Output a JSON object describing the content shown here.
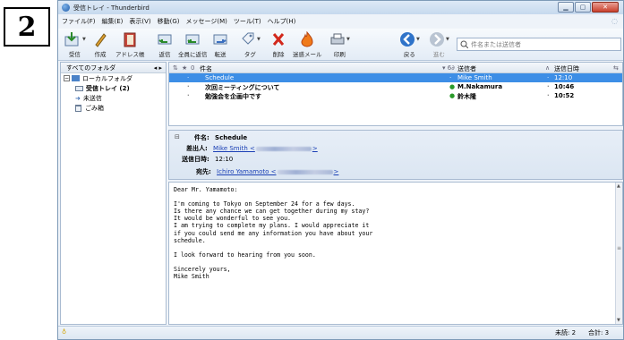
{
  "step": {
    "number": "2"
  },
  "window": {
    "title": "受信トレイ - Thunderbird"
  },
  "menubar": [
    "ファイル(F)",
    "編集(E)",
    "表示(V)",
    "移動(G)",
    "メッセージ(M)",
    "ツール(T)",
    "ヘルプ(H)"
  ],
  "toolbar": {
    "get_label": "受信",
    "write_label": "作成",
    "addressbook_label": "アドレス帳",
    "reply_label": "返信",
    "replyall_label": "全員に返信",
    "forward_label": "転送",
    "tag_label": "タグ",
    "delete_label": "削除",
    "junk_label": "迷惑メール",
    "print_label": "印刷",
    "back_label": "戻る",
    "forward_nav_label": "進む",
    "search_placeholder": "件名または送信者"
  },
  "folders": {
    "header": "すべてのフォルダ",
    "items": [
      {
        "label": "ローカルフォルダ"
      },
      {
        "label": "受信トレイ (2)"
      },
      {
        "label": "未送信"
      },
      {
        "label": "ごみ箱"
      }
    ]
  },
  "message_list": {
    "columns": {
      "subject": "件名",
      "sender": "送信者",
      "date": "送信日時"
    },
    "rows": [
      {
        "subject": "Schedule",
        "sender": "Mike Smith",
        "date": "12:10"
      },
      {
        "subject": "次回ミーティングについて",
        "sender": "M.Nakamura",
        "date": "10:46"
      },
      {
        "subject": "勉強会を企画中です",
        "sender": "鈴木隆",
        "date": "10:52"
      }
    ]
  },
  "message": {
    "subject_label": "件名:",
    "subject": "Schedule",
    "from_label": "差出人:",
    "from_name": "Mike Smith <",
    "from_end": ">",
    "date_label": "送信日時:",
    "date": "12:10",
    "to_label": "宛先:",
    "to_name": "Ichiro Yamamoto <",
    "to_end": ">",
    "body": [
      "Dear Mr. Yamamoto:",
      "",
      "I'm coming to Tokyo on September 24 for a few days.",
      "Is there any chance we can get together during my stay?",
      "It would be wonderful to see you.",
      "I am trying to complete my plans. I would appreciate it",
      "if you could send me any information you have about your",
      "schedule.",
      "",
      "I look forward to hearing from you soon.",
      "",
      "Sincerely yours,",
      "Mike Smith"
    ]
  },
  "status": {
    "unread": "未読: 2",
    "total": "合計: 3"
  }
}
